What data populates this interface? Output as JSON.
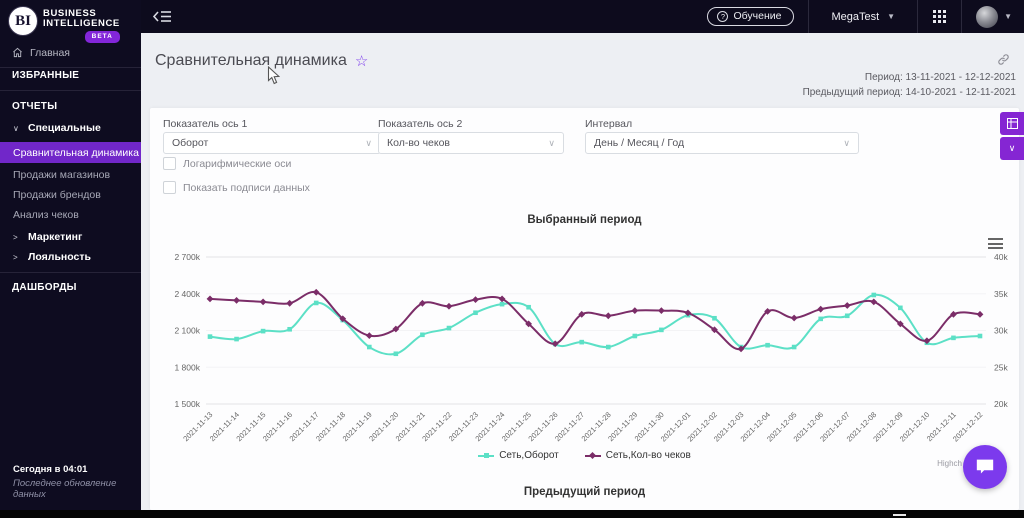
{
  "app": {
    "logo_mark": "BI",
    "logo_line1": "BUSINESS",
    "logo_line2": "INTELLIGENCE",
    "logo_badge": "BETA"
  },
  "topbar": {
    "training_label": "Обучение",
    "training_icon_glyph": "?",
    "account_label": "MegaTest"
  },
  "sidebar": {
    "home": "Главная",
    "favorites_header": "ИЗБРАННЫЕ",
    "reports_header": "ОТЧЕТЫ",
    "special_group": "Специальные",
    "special_items": [
      "Сравнительная динамика",
      "Продажи магазинов",
      "Продажи брендов",
      "Анализ чеков"
    ],
    "marketing_group": "Маркетинг",
    "loyalty_group": "Лояльность",
    "dashboards_header": "ДАШБОРДЫ",
    "footer_time": "Сегодня в 04:01",
    "footer_note": "Последнее обновление данных"
  },
  "header": {
    "title": "Сравнительная динамика",
    "period": "Период: 13-11-2021 - 12-12-2021",
    "prev_period": "Предыдущий период: 14-10-2021 - 12-11-2021"
  },
  "filters": {
    "axis1_label": "Показатель ось 1",
    "axis1_value": "Оборот",
    "axis2_label": "Показатель ось 2",
    "axis2_value": "Кол-во чеков",
    "interval_label": "Интервал",
    "interval_value": "День / Месяц / Год",
    "checkbox_log_label": "Логарифмические оси",
    "checkbox_datalabels_label": "Показать подписи данных"
  },
  "chart_data": {
    "type": "line",
    "title": "Выбранный период",
    "grid": true,
    "legend_position": "bottom",
    "x": [
      "2021-11-13",
      "2021-11-14",
      "2021-11-15",
      "2021-11-16",
      "2021-11-17",
      "2021-11-18",
      "2021-11-19",
      "2021-11-20",
      "2021-11-21",
      "2021-11-22",
      "2021-11-23",
      "2021-11-24",
      "2021-11-25",
      "2021-11-26",
      "2021-11-27",
      "2021-11-28",
      "2021-11-29",
      "2021-11-30",
      "2021-12-01",
      "2021-12-02",
      "2021-12-03",
      "2021-12-04",
      "2021-12-05",
      "2021-12-06",
      "2021-12-07",
      "2021-12-08",
      "2021-12-09",
      "2021-12-10",
      "2021-12-11",
      "2021-12-12"
    ],
    "left_axis": {
      "min": 1500000,
      "max": 2700000,
      "ticks": [
        "2 700k",
        "2 400k",
        "2 100k",
        "1 800k",
        "1 500k"
      ]
    },
    "right_axis": {
      "min": 20000,
      "max": 40000,
      "ticks": [
        "40k",
        "35k",
        "30k",
        "25k",
        "20k"
      ]
    },
    "series": [
      {
        "name": "Сеть,Оборот",
        "axis": "left",
        "color": "#5ce0c6",
        "marker": "square",
        "values": [
          2050000,
          2030000,
          2095000,
          2110000,
          2325000,
          2185000,
          1965000,
          1910000,
          2065000,
          2120000,
          2245000,
          2315000,
          2290000,
          1990000,
          2005000,
          1965000,
          2055000,
          2105000,
          2225000,
          2200000,
          1965000,
          1980000,
          1965000,
          2195000,
          2220000,
          2390000,
          2285000,
          2000000,
          2040000,
          2055000
        ]
      },
      {
        "name": "Сеть,Кол-во чеков",
        "axis": "right",
        "color": "#7b2d68",
        "marker": "diamond",
        "values": [
          34300,
          34100,
          33900,
          33700,
          35200,
          31600,
          29300,
          30200,
          33700,
          33300,
          34200,
          34300,
          30900,
          28200,
          32200,
          32000,
          32700,
          32700,
          32400,
          30100,
          27500,
          32600,
          31700,
          32900,
          33400,
          33900,
          30900,
          28600,
          32200,
          32200
        ]
      }
    ]
  },
  "prev_chart": {
    "title": "Предыдущий период"
  },
  "credit": "Highch"
}
